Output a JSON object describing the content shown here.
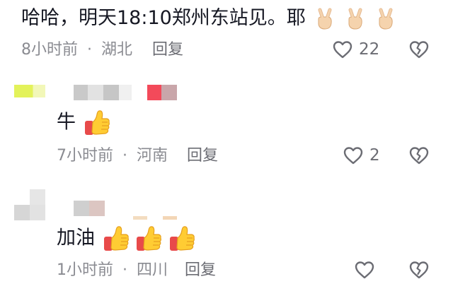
{
  "comments": [
    {
      "text": "哈哈，明天18:10郑州东站见。耶",
      "time": "8小时前",
      "dot": "·",
      "location": "湖北",
      "reply": "回复",
      "likes": "22"
    },
    {
      "text": "牛",
      "time": "7小时前",
      "dot": "·",
      "location": "河南",
      "reply": "回复",
      "likes": "2"
    },
    {
      "text": "加油",
      "time": "1小时前",
      "dot": "·",
      "location": "四川",
      "reply": "回复",
      "likes": ""
    }
  ],
  "colors": {
    "text": "#161823",
    "meta": "#8a8b91",
    "icon": "#6b6c73"
  },
  "icons": {
    "like": "heart-outline-icon",
    "dislike": "broken-heart-outline-icon",
    "victory": "victory-hand-emoji",
    "thumbs": "thumbs-up-emoji"
  }
}
